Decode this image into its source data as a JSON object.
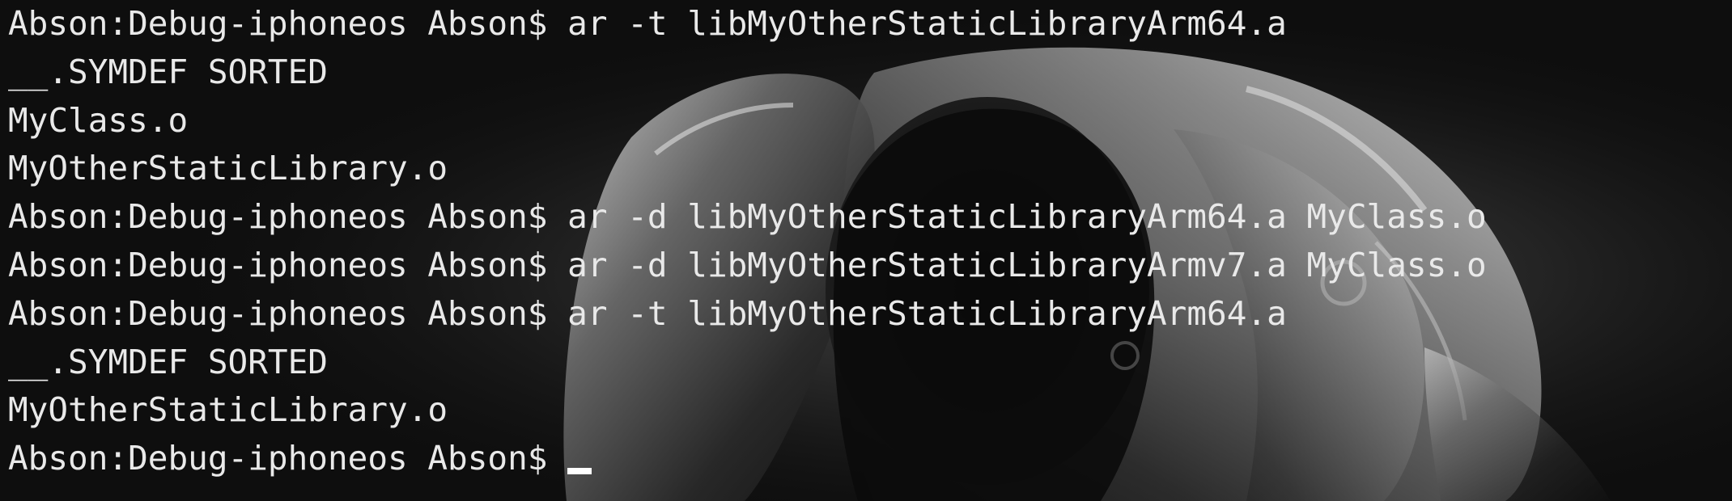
{
  "terminal": {
    "lines": [
      "Abson:Debug-iphoneos Abson$ ar -t libMyOtherStaticLibraryArm64.a",
      "__.SYMDEF SORTED",
      "MyClass.o",
      "MyOtherStaticLibrary.o",
      "Abson:Debug-iphoneos Abson$ ar -d libMyOtherStaticLibraryArm64.a MyClass.o",
      "Abson:Debug-iphoneos Abson$ ar -d libMyOtherStaticLibraryArmv7.a MyClass.o",
      "Abson:Debug-iphoneos Abson$ ar -t libMyOtherStaticLibraryArm64.a",
      "__.SYMDEF SORTED",
      "MyOtherStaticLibrary.o"
    ],
    "prompt": "Abson:Debug-iphoneos Abson$ "
  },
  "colors": {
    "background": "#0e0e0e",
    "text": "#e9e9e9",
    "cursor": "#ffffff"
  }
}
